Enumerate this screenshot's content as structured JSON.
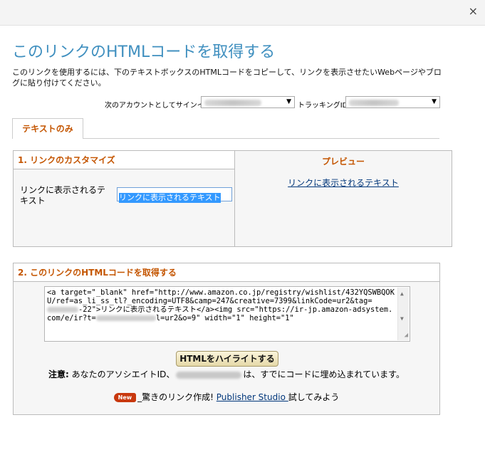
{
  "dialog": {
    "close_glyph": "×",
    "title": "このリンクのHTMLコードを取得する",
    "intro": "このリンクを使用するには、下のテキストボックスのHTMLコードをコピーして、リンクを表示させたいWebページやブログに貼り付けてください。"
  },
  "account": {
    "signin_label": "次のアカウントとしてサインイン",
    "tracking_label": "トラッキングID"
  },
  "tab": {
    "label": "テキストのみ"
  },
  "customize": {
    "heading": "1. リンクのカスタマイズ",
    "field_label": "リンクに表示されるテキスト",
    "field_value": "リンクに表示されるテキスト"
  },
  "preview": {
    "heading": "プレビュー",
    "link_text": "リンクに表示されるテキスト"
  },
  "code": {
    "heading": "2. このリンクのHTMLコードを取得する",
    "part1": "<a target=\"_blank\" href=\"http://www.amazon.co.jp/registry/wishlist/432YQSWBQOKU/ref=as_li_ss_tl?_encoding=UTF8&camp=247&creative=7399&linkCode=ur2&tag=",
    "part2": "-22\">リンクに表示されるテキスト</a><img src=\"https://ir-jp.amazon-adsystem.com/e/ir?t=",
    "part3": "l=ur2&o=9\" width=\"1\" height=\"1\"",
    "highlight_button": "HTMLをハイライトする",
    "note_bold": "注意:",
    "note_before": " あなたのアソシエイトID、",
    "note_after": "は、すでにコードに埋め込まれています。"
  },
  "promo": {
    "badge": "New",
    "lead": "_驚きのリンク作成! ",
    "link": "Publisher Studio ",
    "tail": "試してみよう"
  }
}
